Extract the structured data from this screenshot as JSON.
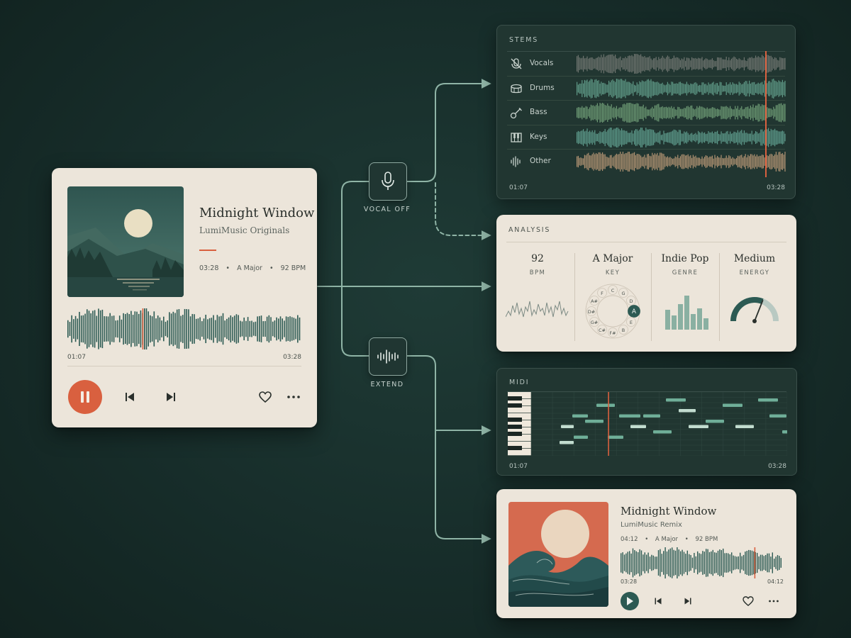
{
  "main_player": {
    "title": "Midnight Window",
    "artist": "LumiMusic Originals",
    "duration": "03:28",
    "key": "A Major",
    "bpm": "92 BPM",
    "current_time": "01:07",
    "total_time": "03:28",
    "progress": 0.32
  },
  "nodes": {
    "vocal_off": "VOCAL OFF",
    "extend": "EXTEND"
  },
  "stems": {
    "title": "STEMS",
    "items": [
      {
        "label": "Vocals",
        "icon": "mic-off-icon",
        "color": "#6e746f"
      },
      {
        "label": "Drums",
        "icon": "drum-icon",
        "color": "#5f9a87"
      },
      {
        "label": "Bass",
        "icon": "guitar-icon",
        "color": "#6d9a74"
      },
      {
        "label": "Keys",
        "icon": "piano-keys-icon",
        "color": "#5e9c8c"
      },
      {
        "label": "Other",
        "icon": "waveform-icon",
        "color": "#b09272"
      }
    ],
    "start_time": "01:07",
    "end_time": "03:28",
    "playhead": 0.9
  },
  "analysis": {
    "title": "ANALYSIS",
    "bpm": {
      "value": "92",
      "label": "BPM"
    },
    "key": {
      "value": "A Major",
      "label": "KEY",
      "wheel": [
        "C",
        "G",
        "D",
        "A",
        "E",
        "B",
        "F#",
        "C#",
        "G#",
        "D#",
        "A#",
        "F"
      ],
      "selected": "A"
    },
    "genre": {
      "value": "Indie Pop",
      "label": "GENRE"
    },
    "energy": {
      "value": "Medium",
      "label": "ENERGY",
      "level": 0.62
    }
  },
  "midi": {
    "title": "MIDI",
    "start_time": "01:07",
    "end_time": "03:28",
    "playhead": 0.3
  },
  "remix": {
    "title": "Midnight Window",
    "artist": "LumiMusic Remix",
    "duration": "04:12",
    "key": "A Major",
    "bpm": "92 BPM",
    "current_time": "03:28",
    "total_time": "04:12",
    "progress": 0.82
  },
  "colors": {
    "accent": "#d9603f",
    "teal": "#2c5a53",
    "line": "#8fb4a6"
  }
}
